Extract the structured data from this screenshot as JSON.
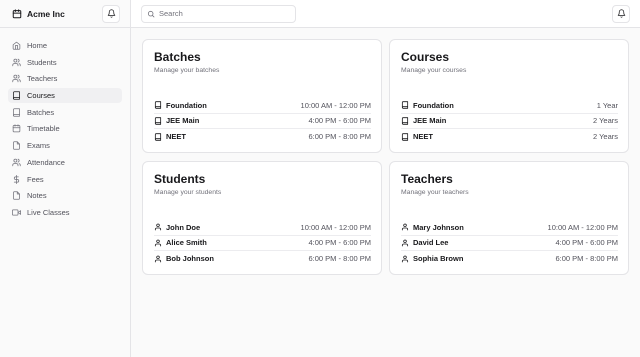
{
  "brand": {
    "name": "Acme Inc"
  },
  "search": {
    "placeholder": "Search"
  },
  "sidebar": {
    "items": [
      {
        "label": "Home",
        "icon": "home-icon"
      },
      {
        "label": "Students",
        "icon": "users-icon"
      },
      {
        "label": "Teachers",
        "icon": "users-icon"
      },
      {
        "label": "Courses",
        "icon": "book-icon",
        "active": true
      },
      {
        "label": "Batches",
        "icon": "book-icon"
      },
      {
        "label": "Timetable",
        "icon": "calendar-icon"
      },
      {
        "label": "Exams",
        "icon": "file-icon"
      },
      {
        "label": "Attendance",
        "icon": "users-icon"
      },
      {
        "label": "Fees",
        "icon": "dollar-icon"
      },
      {
        "label": "Notes",
        "icon": "file-icon"
      },
      {
        "label": "Live Classes",
        "icon": "video-icon"
      }
    ]
  },
  "cards": {
    "batches": {
      "title": "Batches",
      "subtitle": "Manage your batches",
      "rows": [
        {
          "name": "Foundation",
          "value": "10:00 AM - 12:00 PM"
        },
        {
          "name": "JEE Main",
          "value": "4:00 PM - 6:00 PM"
        },
        {
          "name": "NEET",
          "value": "6:00 PM - 8:00 PM"
        }
      ]
    },
    "courses": {
      "title": "Courses",
      "subtitle": "Manage your courses",
      "rows": [
        {
          "name": "Foundation",
          "value": "1 Year"
        },
        {
          "name": "JEE Main",
          "value": "2 Years"
        },
        {
          "name": "NEET",
          "value": "2 Years"
        }
      ]
    },
    "students": {
      "title": "Students",
      "subtitle": "Manage your students",
      "rows": [
        {
          "name": "John Doe",
          "value": "10:00 AM - 12:00 PM"
        },
        {
          "name": "Alice Smith",
          "value": "4:00 PM - 6:00 PM"
        },
        {
          "name": "Bob Johnson",
          "value": "6:00 PM - 8:00 PM"
        }
      ]
    },
    "teachers": {
      "title": "Teachers",
      "subtitle": "Manage your teachers",
      "rows": [
        {
          "name": "Mary Johnson",
          "value": "10:00 AM - 12:00 PM"
        },
        {
          "name": "David Lee",
          "value": "4:00 PM - 6:00 PM"
        },
        {
          "name": "Sophia Brown",
          "value": "6:00 PM - 8:00 PM"
        }
      ]
    }
  }
}
